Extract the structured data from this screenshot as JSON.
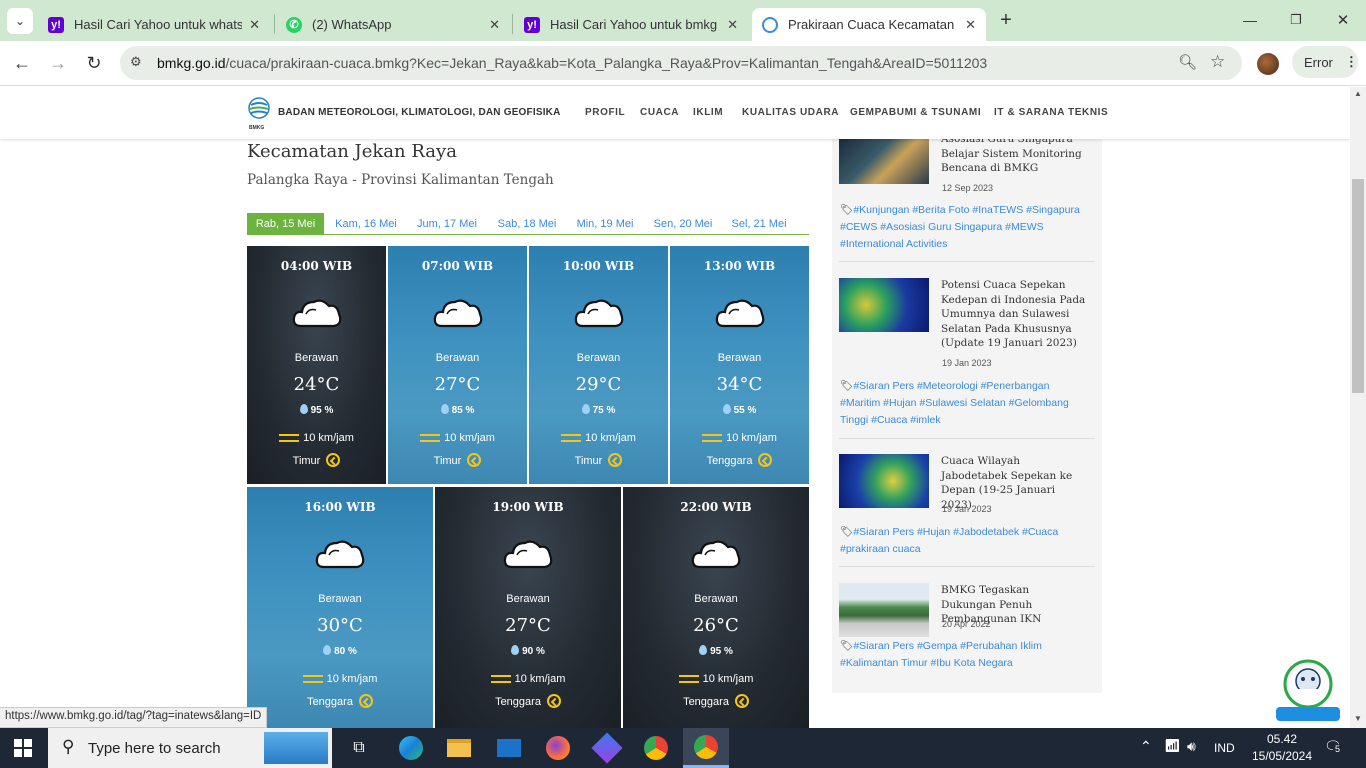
{
  "browser": {
    "tabs": [
      {
        "title": "Hasil Cari Yahoo untuk whatsapp",
        "icon": "yahoo-icon"
      },
      {
        "title": "(2) WhatsApp",
        "icon": "whatsapp-icon"
      },
      {
        "title": "Hasil Cari Yahoo untuk bmkg pa",
        "icon": "yahoo-icon"
      },
      {
        "title": "Prakiraan Cuaca Kecamatan Jek",
        "icon": "bmkg-icon"
      }
    ],
    "url_host": "bmkg.go.id",
    "url_path": "/cuaca/prakiraan-cuaca.bmkg?Kec=Jekan_Raya&kab=Kota_Palangka_Raya&Prov=Kalimantan_Tengah&AreaID=5011203",
    "error_label": "Error",
    "status_url": "https://www.bmkg.go.id/tag/?tag=inatews&lang=ID"
  },
  "site": {
    "org": "BADAN METEOROLOGI, KLIMATOLOGI, DAN GEOFISIKA",
    "logo_text": "BMKG",
    "nav": [
      "PROFIL",
      "CUACA",
      "IKLIM",
      "KUALITAS UDARA",
      "GEMPABUMI & TSUNAMI",
      "IT & SARANA TEKNIS"
    ]
  },
  "location": {
    "kecamatan": "Kecamatan Jekan Raya",
    "province": "Palangka Raya - Provinsi Kalimantan Tengah"
  },
  "days": [
    "Rab, 15 Mei",
    "Kam, 16 Mei",
    "Jum, 17 Mei",
    "Sab, 18 Mei",
    "Min, 19 Mei",
    "Sen, 20 Mei",
    "Sel, 21 Mei"
  ],
  "forecast": [
    {
      "time": "04:00 WIB",
      "cond": "Berawan",
      "temp": "24°C",
      "hum": "95 %",
      "wind": "10 km/jam",
      "dir": "Timur"
    },
    {
      "time": "07:00 WIB",
      "cond": "Berawan",
      "temp": "27°C",
      "hum": "85 %",
      "wind": "10 km/jam",
      "dir": "Timur"
    },
    {
      "time": "10:00 WIB",
      "cond": "Berawan",
      "temp": "29°C",
      "hum": "75 %",
      "wind": "10 km/jam",
      "dir": "Timur"
    },
    {
      "time": "13:00 WIB",
      "cond": "Berawan",
      "temp": "34°C",
      "hum": "55 %",
      "wind": "10 km/jam",
      "dir": "Tenggara"
    },
    {
      "time": "16:00 WIB",
      "cond": "Berawan",
      "temp": "30°C",
      "hum": "80 %",
      "wind": "10 km/jam",
      "dir": "Tenggara"
    },
    {
      "time": "19:00 WIB",
      "cond": "Berawan",
      "temp": "27°C",
      "hum": "90 %",
      "wind": "10 km/jam",
      "dir": "Tenggara"
    },
    {
      "time": "22:00 WIB",
      "cond": "Berawan",
      "temp": "26°C",
      "hum": "95 %",
      "wind": "10 km/jam",
      "dir": "Tenggara"
    }
  ],
  "news": [
    {
      "title": "Asosiasi Guru Singapura Belajar Sistem Monitoring Bencana di BMKG",
      "date": "12 Sep 2023",
      "tags": "#Kunjungan #Berita Foto #InaTEWS #Singapura #CEWS #Asosiasi Guru Singapura #MEWS #International Activities"
    },
    {
      "title": "Potensi Cuaca Sepekan Kedepan di Indonesia Pada Umumnya dan Sulawesi Selatan Pada Khususnya (Update 19 Januari 2023)",
      "date": "19 Jan 2023",
      "tags": "#Siaran Pers #Meteorologi #Penerbangan #Maritim #Hujan #Sulawesi Selatan #Gelombang Tinggi #Cuaca #imlek"
    },
    {
      "title": "Cuaca Wilayah Jabodetabek Sepekan ke Depan (19-25 Januari 2023)",
      "date": "19 Jan 2023",
      "tags": "#Siaran Pers #Hujan #Jabodetabek #Cuaca #prakiraan cuaca"
    },
    {
      "title": "BMKG Tegaskan Dukungan Penuh Pembangunan IKN",
      "date": "20 Apr 2022",
      "tags": "#Siaran Pers #Gempa #Perubahan Iklim #Kalimantan Timur #Ibu Kota Negara"
    }
  ],
  "taskbar": {
    "search_placeholder": "Type here to search",
    "lang": "IND",
    "time": "05.42",
    "date": "15/05/2024",
    "notif": "5"
  }
}
